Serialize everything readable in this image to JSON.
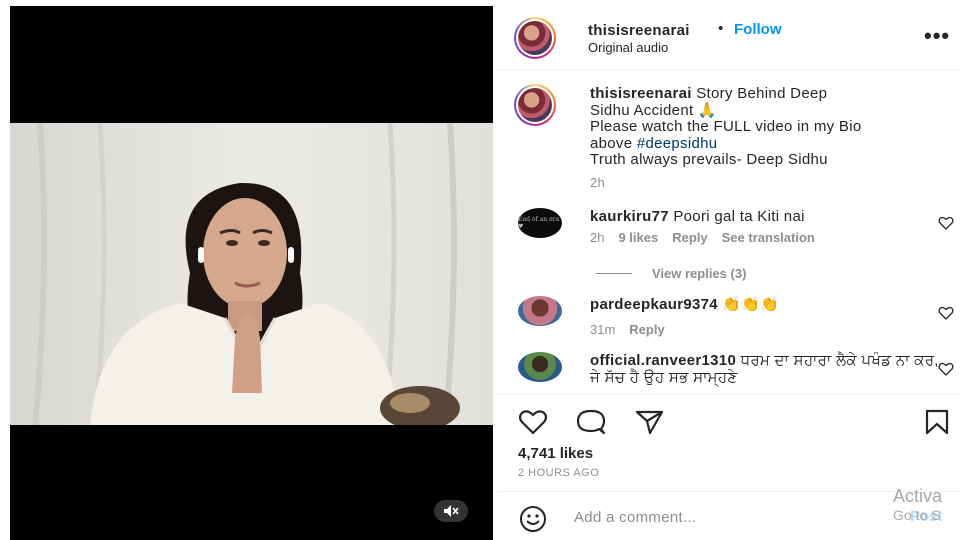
{
  "post": {
    "username": "thisisreenarai",
    "dot": "•",
    "follow_label": "Follow",
    "audio": "Original audio",
    "more_icon": "more-horizontal-icon",
    "mute_icon": "muted-speaker-icon"
  },
  "caption": {
    "username": "thisisreenarai",
    "line1": "Story Behind Deep",
    "line2": "Sidhu Accident 🙏",
    "line3": "Please watch the FULL video in my Bio",
    "line4_prefix": "above",
    "hashtag": "#deepsidhu",
    "line5": "Truth always prevails- Deep Sidhu",
    "time": "2h"
  },
  "comments": [
    {
      "username": "kaurkiru77",
      "text": "Poori gal ta Kiti nai",
      "time": "2h",
      "likes": "9 likes",
      "reply": "Reply",
      "translate": "See translation",
      "avatar_text": "End of an era ♥"
    },
    {
      "username": "pardeepkaur9374",
      "text": "👏👏👏",
      "time": "31m",
      "reply": "Reply"
    },
    {
      "username": "official.ranveer1310",
      "text": "ਧਰਮ ਦਾ ਸਹਾਰਾ ਲੈਕੇ ਪਖੰਡ ਨਾ ਕਰ, ਜੇ ਸੱਚ ਹੈ ਉਹ ਸਭ ਸਾਮ੍ਹਣੇ"
    }
  ],
  "view_replies": "View replies (3)",
  "actions": {
    "like_icon": "heart-icon",
    "comment_icon": "comment-icon",
    "share_icon": "share-icon",
    "save_icon": "bookmark-icon"
  },
  "likes": "4,741 likes",
  "posted": "2 HOURS AGO",
  "comment_box": {
    "placeholder": "Add a comment...",
    "post_label": "Post",
    "emoji_icon": "emoji-icon"
  },
  "watermark": {
    "line1": "Activa",
    "line2": "Go to S"
  }
}
